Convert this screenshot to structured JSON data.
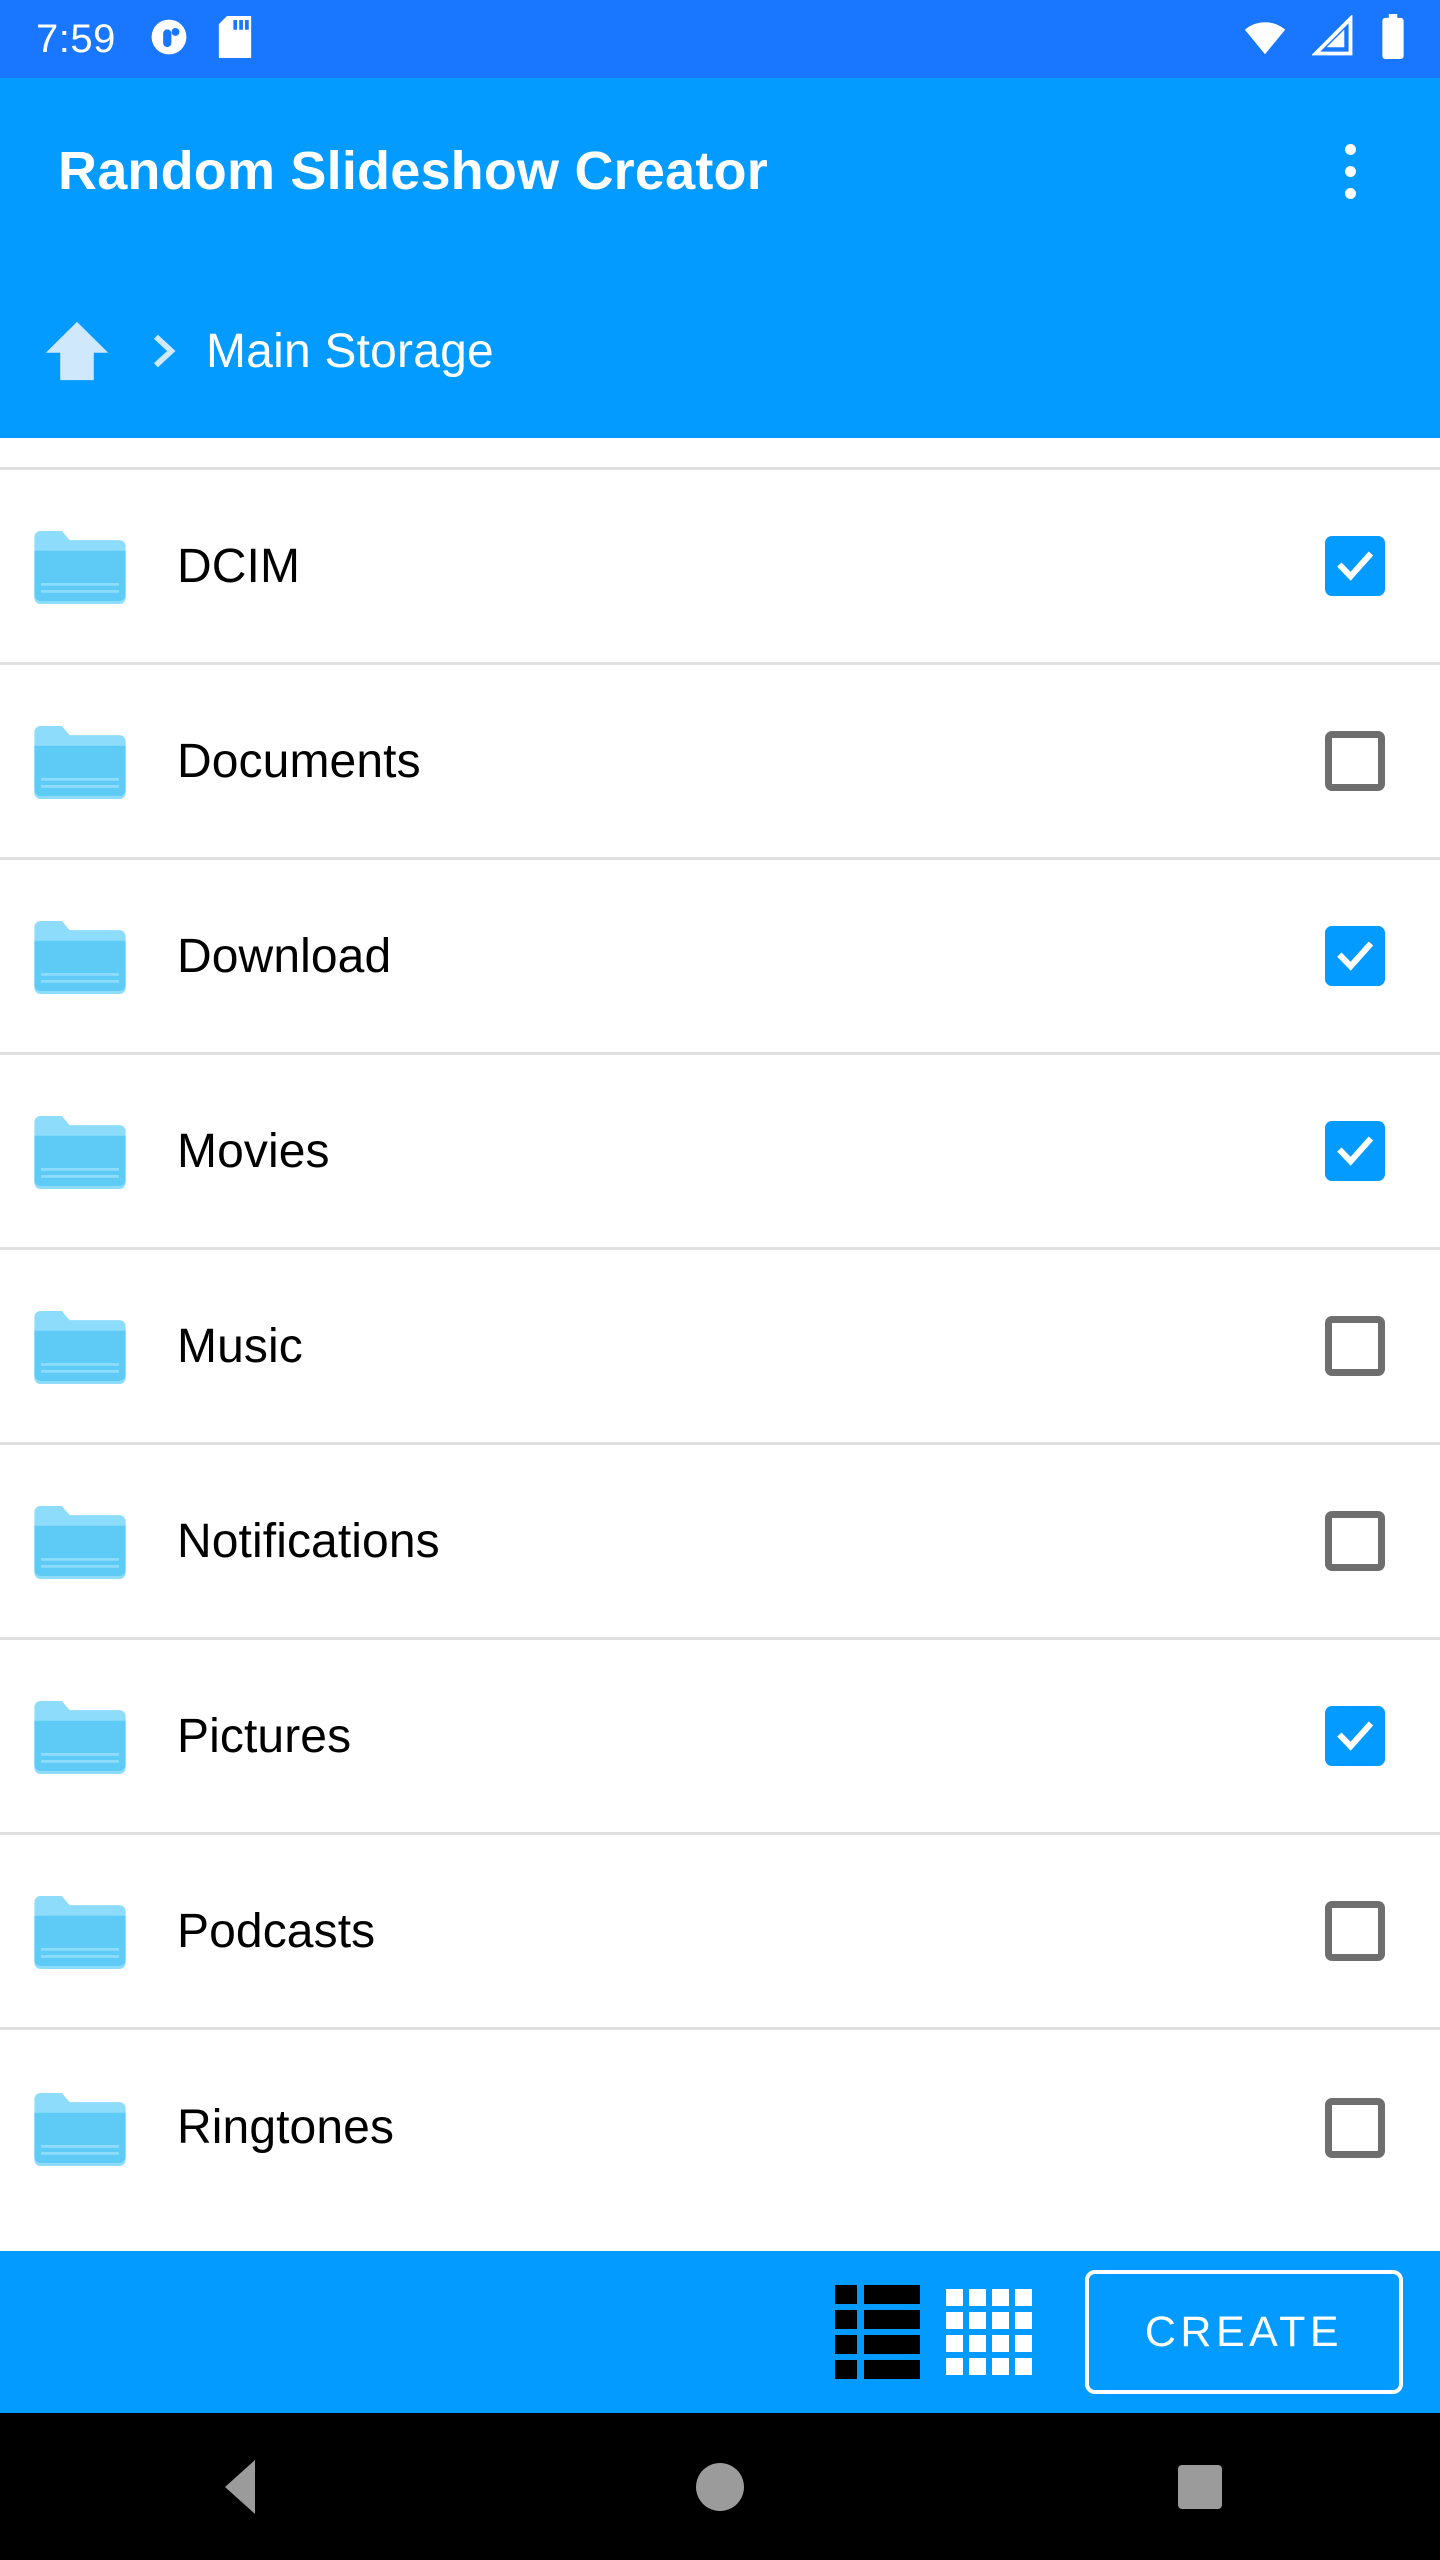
{
  "status_bar": {
    "time": "7:59",
    "left_icons": [
      "app-notification-icon",
      "sd-card-icon"
    ],
    "right_icons": [
      "wifi-icon",
      "cellular-signal-icon",
      "battery-icon"
    ],
    "background_color": "#1877fe"
  },
  "app_bar": {
    "title": "Random Slideshow Creator",
    "overflow_menu_icon": "more-vertical-icon",
    "background_color": "#039bff"
  },
  "breadcrumb": {
    "home_icon": "home-icon",
    "separator": "chevron-right-icon",
    "path_label": "Main Storage"
  },
  "file_list": {
    "partial_top_row": true,
    "folder_icon": "folder-icon",
    "items": [
      {
        "label": "DCIM",
        "checked": true
      },
      {
        "label": "Documents",
        "checked": false
      },
      {
        "label": "Download",
        "checked": true
      },
      {
        "label": "Movies",
        "checked": true
      },
      {
        "label": "Music",
        "checked": false
      },
      {
        "label": "Notifications",
        "checked": false
      },
      {
        "label": "Pictures",
        "checked": true
      },
      {
        "label": "Podcasts",
        "checked": false
      },
      {
        "label": "Ringtones",
        "checked": false
      }
    ]
  },
  "bottom_bar": {
    "list_view_icon": "list-view-icon",
    "grid_view_icon": "grid-view-icon",
    "create_label": "CREATE",
    "background_color": "#039bff"
  },
  "nav_bar": {
    "back_icon": "back-triangle-icon",
    "home_icon": "home-circle-icon",
    "recents_icon": "recents-square-icon"
  },
  "colors": {
    "status_blue": "#1877fe",
    "primary_blue": "#039bff",
    "checkbox_checked": "#039bff",
    "checkbox_border": "#6e6e6e",
    "folder_body": "#5ecbf7",
    "folder_top": "#8ddcfb",
    "divider": "#e0e0e0"
  }
}
